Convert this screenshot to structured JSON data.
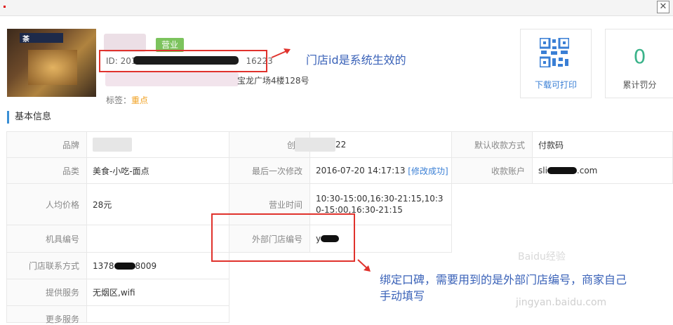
{
  "store": {
    "status_badge": "营业",
    "id_label": "ID: 201",
    "id_suffix": "16223",
    "address_suffix": "宝龙广场4楼128号",
    "tag_label": "标签：",
    "tag_value": "重点",
    "photo_sign": "茶"
  },
  "annotations": {
    "id_note": "门店id是系统生效的",
    "external_note_line1": "绑定口碑，需要用到的是外部门店编号，商家自己",
    "external_note_line2": "手动填写"
  },
  "cards": {
    "qr_label": "下载可打印",
    "penalty_value": "0",
    "penalty_label": "累计罚分"
  },
  "section_title": "基本信息",
  "info": {
    "brand_label": "品牌",
    "category_label": "品类",
    "category_value": "美食-小吃-面点",
    "avg_price_label": "人均价格",
    "avg_price_value": "28元",
    "machine_label": "机具编号",
    "contact_label": "门店联系方式",
    "contact_prefix": "1378",
    "contact_suffix": "8009",
    "service_label": "提供服务",
    "service_value": "无烟区,wifi",
    "more_label": "更多服务",
    "created_label": "创",
    "created_suffix": "22",
    "modified_label": "最后一次修改",
    "modified_value": "2016-07-20 14:17:13",
    "modified_status": "[修改成功]",
    "hours_label": "营业时间",
    "hours_value": "10:30-15:00,16:30-21:15,10:30-15:00,16:30-21:15",
    "external_id_label": "外部门店编号",
    "external_id_prefix": "y",
    "default_pay_label": "默认收款方式",
    "default_pay_value": "付款码",
    "account_label": "收款账户",
    "account_prefix": "sli",
    "account_suffix": ".com"
  },
  "watermark": {
    "line1": "Baidu经验",
    "line2": "jingyan.baidu.com"
  },
  "colors": {
    "accent_blue": "#3a7fd5",
    "annotation_red": "#e0322c",
    "badge_green": "#7cc35d",
    "number_green": "#3bb38a"
  }
}
